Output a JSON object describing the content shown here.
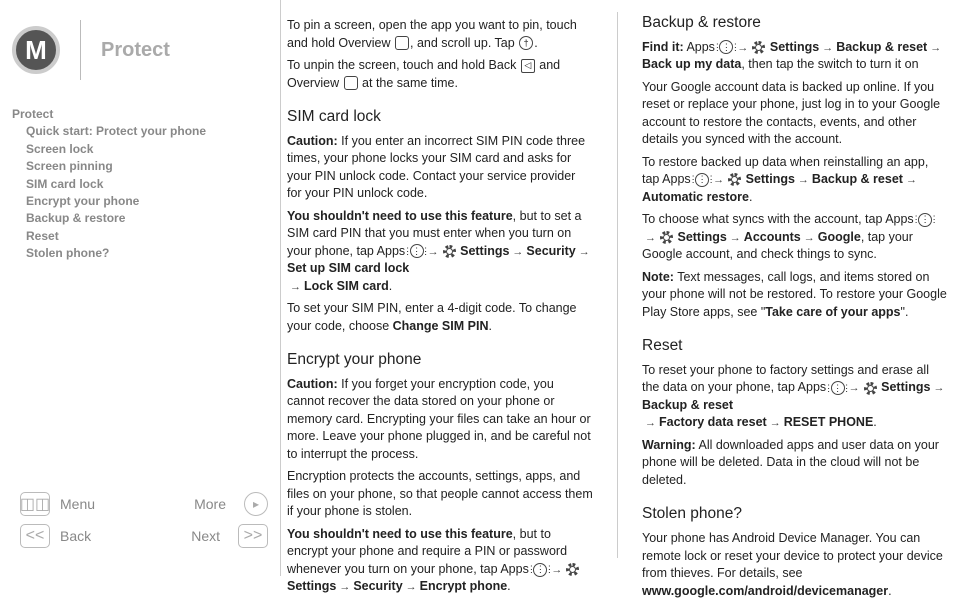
{
  "header": {
    "title": "Protect"
  },
  "toc": {
    "items": [
      {
        "label": "Protect",
        "level": 0
      },
      {
        "label": "Quick start: Protect your phone",
        "level": 1
      },
      {
        "label": "Screen lock",
        "level": 1
      },
      {
        "label": "Screen pinning",
        "level": 1
      },
      {
        "label": "SIM card lock",
        "level": 1
      },
      {
        "label": "Encrypt your phone",
        "level": 1
      },
      {
        "label": "Backup & restore",
        "level": 1
      },
      {
        "label": "Reset",
        "level": 1
      },
      {
        "label": "Stolen phone?",
        "level": 1
      }
    ]
  },
  "nav": {
    "menu": "Menu",
    "back": "Back",
    "more": "More",
    "next": "Next",
    "prev_sym": "<<",
    "next_sym": ">>"
  },
  "col1": {
    "pin1a": "To pin a screen, open the app you want to pin, touch and hold Overview ",
    "pin1b": ", and scroll up. Tap ",
    "pin1c": ".",
    "unpin1a": "To unpin the screen, touch and hold Back ",
    "unpin1b": " and Overview ",
    "unpin1c": " at the same time.",
    "sim_h": "SIM card lock",
    "sim_caution_l": "Caution:",
    "sim_caution": " If you enter an incorrect SIM PIN code three times, your phone locks your SIM card and asks for your PIN unlock code. Contact your service provider for your PIN unlock code.",
    "sim_no_need": "You shouldn't need to use this feature",
    "sim_no_need2": ", but to set a SIM card PIN that you must enter when you turn on your phone, tap Apps ",
    "sim_path1": "Settings",
    "sim_path2": "Security",
    "sim_path3": "Set up SIM card lock",
    "sim_path4": "Lock SIM card",
    "sim_set": "To set your SIM PIN, enter a 4-digit code. To change your code, choose ",
    "sim_change": "Change SIM PIN",
    "enc_h": "Encrypt your phone",
    "enc_caution": " If you forget your encryption code, you cannot recover the data stored on your phone or memory card. Encrypting your files can take an hour or more. Leave your phone plugged in, and be careful not to interrupt the process.",
    "enc_p2": "Encryption protects the accounts, settings, apps, and files on your phone, so that people cannot access them if your phone is stolen.",
    "enc_no_need2": ", but to encrypt your phone and require a PIN or password whenever you turn on your phone, tap Apps ",
    "enc_path2": "Security",
    "enc_path3": "Encrypt phone"
  },
  "col2": {
    "br_h": "Backup & restore",
    "find_l": "Find it:",
    "find_apps": " Apps ",
    "br_s": "Settings",
    "br_br": "Backup & reset",
    "br_bmd": "Back up my data",
    "br_tail": ", then tap the switch to turn it on",
    "br_p1": "Your Google account data is backed up online. If you reset or replace your phone, just log in to your Google account to restore the contacts, events, and other details you synced with the account.",
    "br_p2a": "To restore backed up data when reinstalling an app, tap Apps ",
    "br_auto": "Automatic restore",
    "br_p3a": "To choose what syncs with the account, tap Apps ",
    "br_acc": "Accounts",
    "br_goog": "Google",
    "br_p3b": ", tap your Google account, and check things to sync.",
    "note_l": "Note:",
    "br_note": " Text messages, call logs, and items stored on your phone will not be restored. To restore your Google Play Store apps, see \"",
    "br_take": "Take care of your apps",
    "br_note2": "\".",
    "reset_h": "Reset",
    "reset_p1a": "To reset your phone to factory settings and erase all the data on your phone, tap Apps ",
    "reset_fdr": "Factory data reset",
    "reset_rp": "RESET PHONE",
    "warn_l": "Warning:",
    "reset_warn": " All downloaded apps and user data on your phone will be deleted. Data in the cloud will not be deleted.",
    "stolen_h": "Stolen phone?",
    "stolen_p": "Your phone has Android Device Manager. You can remote lock or reset your device to protect your device from thieves. For details, see ",
    "stolen_url": "www.google.com/android/devicemanager"
  },
  "icons": {
    "overview": "",
    "pin": "†",
    "back": "◁",
    "apps": "⋮⋮⋮",
    "menu_grid": "⊞"
  }
}
